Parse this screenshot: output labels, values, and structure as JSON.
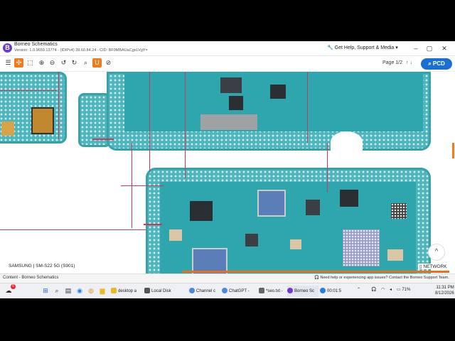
{
  "titlebar": {
    "app_name": "Borneo Schematics",
    "version_line": "Version: 1.0.9659.13774 - (IDIPv4)  39.60.84.24 - CID: BF9MBAUaCgxLVgY=",
    "help_label": "Get Help, Support & Media",
    "help_chevron": "▾",
    "minimize_label": "–",
    "maximize_label": "▢",
    "close_label": "✕"
  },
  "toolbar": {
    "page_indicator": "Page 1/2",
    "page_up": "↑",
    "page_down": "↓",
    "pcd_label": "PCD"
  },
  "canvas": {
    "model_label": "SAMSUNG | SM-S22 5G (S901)",
    "network_label": "NETWORK",
    "scroll_up": "^",
    "trace_color": "#c83a5a",
    "board_color": "#4fb6bd"
  },
  "statusbar": {
    "left_text": "Content - Borneo Schematics",
    "right_text": "Need help or experiencing app issues? Contact the Borneo Support Team."
  },
  "taskbar": {
    "badge_count": "6",
    "apps": [
      {
        "label": "desktop a",
        "color": "#e8b92b"
      },
      {
        "label": "Local Disk",
        "color": "#555"
      },
      {
        "label": "Channel c",
        "color": "#4a8ad6"
      },
      {
        "label": "ChatGPT -",
        "color": "#4a8ad6"
      },
      {
        "label": "*seo.txt -",
        "color": "#666"
      },
      {
        "label": "Borneo Sc",
        "color": "#6a3cc9"
      },
      {
        "label": "00:01:5",
        "color": "#2a7de1"
      }
    ],
    "battery": "71%",
    "time": "11:31 PM",
    "date": "8/12/2026"
  }
}
